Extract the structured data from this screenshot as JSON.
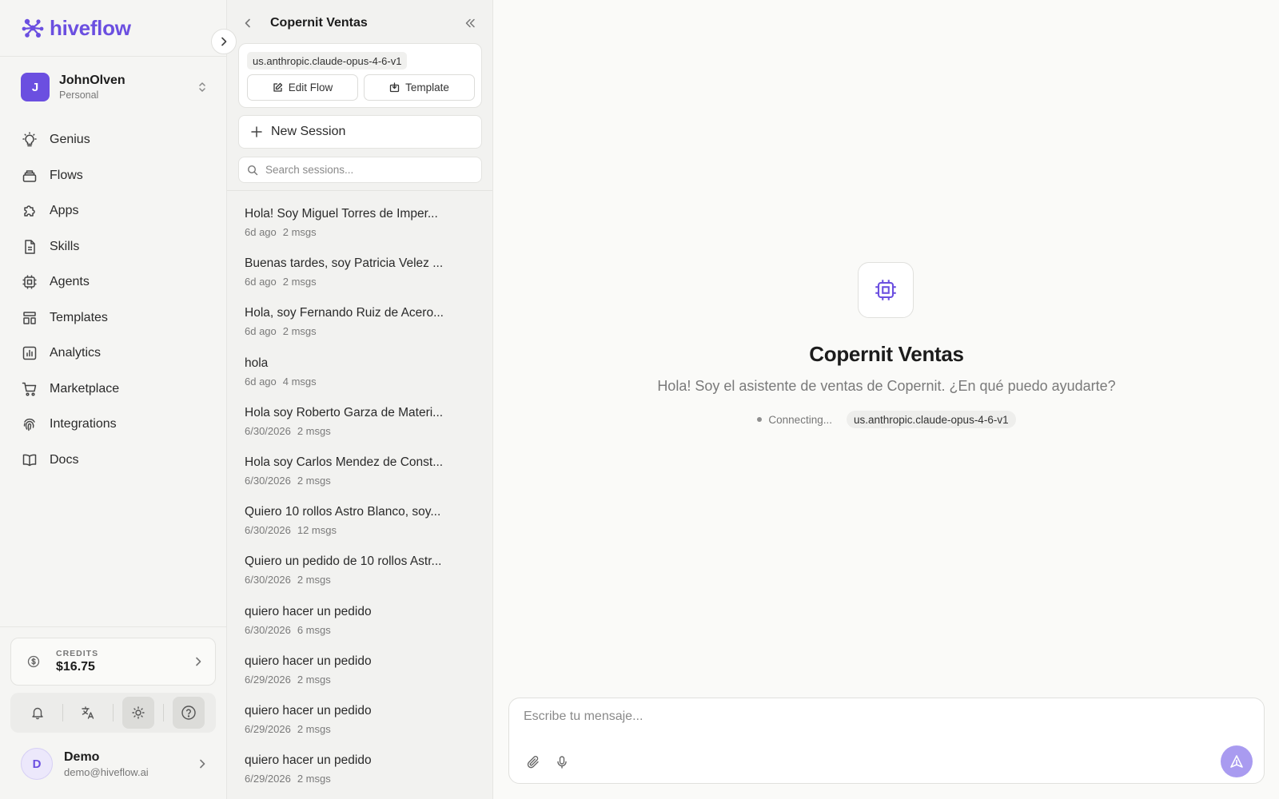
{
  "brand": {
    "name": "hiveflow",
    "accent": "#6b4fe0"
  },
  "workspace": {
    "initial": "J",
    "name": "JohnOlven",
    "type": "Personal"
  },
  "nav": {
    "items": [
      {
        "label": "Genius",
        "icon": "lightbulb-icon"
      },
      {
        "label": "Flows",
        "icon": "layers-icon"
      },
      {
        "label": "Apps",
        "icon": "puzzle-icon"
      },
      {
        "label": "Skills",
        "icon": "document-icon"
      },
      {
        "label": "Agents",
        "icon": "chip-icon"
      },
      {
        "label": "Templates",
        "icon": "layout-icon"
      },
      {
        "label": "Analytics",
        "icon": "bar-chart-icon"
      },
      {
        "label": "Marketplace",
        "icon": "cart-icon"
      },
      {
        "label": "Integrations",
        "icon": "fingerprint-icon"
      },
      {
        "label": "Docs",
        "icon": "book-icon"
      }
    ]
  },
  "credits": {
    "label": "CREDITS",
    "value": "$16.75"
  },
  "user": {
    "initial": "D",
    "name": "Demo",
    "email": "demo@hiveflow.ai"
  },
  "panel": {
    "title": "Copernit Ventas",
    "model": "us.anthropic.claude-opus-4-6-v1",
    "edit_label": "Edit Flow",
    "template_label": "Template",
    "new_session_label": "New Session",
    "search_placeholder": "Search sessions..."
  },
  "sessions": [
    {
      "title": "Hola! Soy Miguel Torres de Imper...",
      "date": "6d ago",
      "msgs": "2 msgs"
    },
    {
      "title": "Buenas tardes, soy Patricia Velez ...",
      "date": "6d ago",
      "msgs": "2 msgs"
    },
    {
      "title": "Hola, soy Fernando Ruiz de Acero...",
      "date": "6d ago",
      "msgs": "2 msgs"
    },
    {
      "title": "hola",
      "date": "6d ago",
      "msgs": "4 msgs"
    },
    {
      "title": "Hola soy Roberto Garza de Materi...",
      "date": "6/30/2026",
      "msgs": "2 msgs"
    },
    {
      "title": "Hola soy Carlos Mendez de Const...",
      "date": "6/30/2026",
      "msgs": "2 msgs"
    },
    {
      "title": "Quiero 10 rollos Astro Blanco, soy...",
      "date": "6/30/2026",
      "msgs": "12 msgs"
    },
    {
      "title": "Quiero un pedido de 10 rollos Astr...",
      "date": "6/30/2026",
      "msgs": "2 msgs"
    },
    {
      "title": "quiero hacer un pedido",
      "date": "6/30/2026",
      "msgs": "6 msgs"
    },
    {
      "title": "quiero hacer un pedido",
      "date": "6/29/2026",
      "msgs": "2 msgs"
    },
    {
      "title": "quiero hacer un pedido",
      "date": "6/29/2026",
      "msgs": "2 msgs"
    },
    {
      "title": "quiero hacer un pedido",
      "date": "6/29/2026",
      "msgs": "2 msgs"
    }
  ],
  "main": {
    "title": "Copernit Ventas",
    "subtitle": "Hola! Soy el asistente de ventas de Copernit. ¿En qué puedo ayudarte?",
    "status": "Connecting...",
    "model": "us.anthropic.claude-opus-4-6-v1",
    "composer_placeholder": "Escribe tu mensaje..."
  }
}
